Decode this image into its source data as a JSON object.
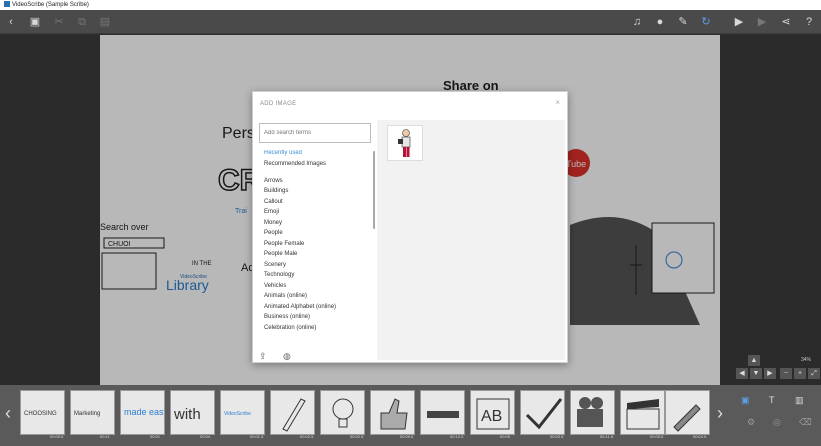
{
  "window": {
    "title": "VideoScribe (Sample Scribe)"
  },
  "toolbar": {
    "left_icons": [
      "back-icon",
      "save-icon",
      "cut-icon",
      "copy-icon",
      "paste-icon"
    ],
    "right_icons": [
      "music-icon",
      "voiceover-icon",
      "pen-icon",
      "refresh-icon",
      "play-from-icon",
      "play-icon",
      "share-icon",
      "help-icon"
    ]
  },
  "canvas": {
    "headline_share": "Share on",
    "search_over": "Search over",
    "search_box": "CHUOI",
    "in_the": "IN THE",
    "videoscribe": "VideoScribe",
    "library": "Library",
    "pers": "Pers",
    "cre": "CRE",
    "youtube": "Tube",
    "trai": "Trai",
    "ad": "Ad"
  },
  "dialog": {
    "title": "ADD IMAGE",
    "close": "×",
    "search_placeholder": "Add search terms",
    "categories": [
      "Recently used",
      "Recommended Images",
      "",
      "Arrows",
      "Buildings",
      "Callout",
      "Emoji",
      "Money",
      "People",
      "People Female",
      "People Male",
      "Scenery",
      "Technology",
      "Vehicles",
      "Animals (online)",
      "Animated Alphabet (online)",
      "Business (online)",
      "Celebration (online)"
    ],
    "footer_icons": [
      "import-image-icon",
      "web-image-icon"
    ]
  },
  "zoom": {
    "level": "34%"
  },
  "timeline": {
    "tiles": [
      {
        "label": "CHOOSING",
        "time": "00:09.5"
      },
      {
        "label": "Marketing",
        "time": "00:11"
      },
      {
        "label": "made easy",
        "time": "00:01"
      },
      {
        "label": "with",
        "time": "00:04"
      },
      {
        "label": "VideoScribe",
        "time": "00:01.5"
      },
      {
        "label": "pencil",
        "time": "00:02.5"
      },
      {
        "label": "lightbulb",
        "time": "00:02.5"
      },
      {
        "label": "thumbs up",
        "time": "00:09.5"
      },
      {
        "label": "marker",
        "time": "00:12.5"
      },
      {
        "label": "AB",
        "time": "00:05"
      },
      {
        "label": "check",
        "time": "00:03.5"
      },
      {
        "label": "camera",
        "time": "00:11.5"
      },
      {
        "label": "clapper",
        "time": "00:05.5"
      },
      {
        "label": "brush",
        "time": "00:04.5"
      }
    ]
  },
  "colors": {
    "accent": "#4aa0ea",
    "link": "#3a8fd9"
  }
}
